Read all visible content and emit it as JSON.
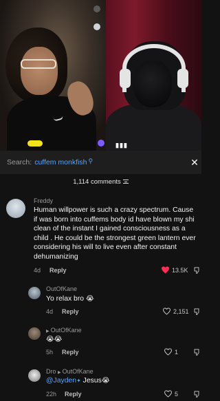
{
  "search": {
    "label": "Search:",
    "query": "cuffem monkfish",
    "search_icon": "search-icon",
    "close_icon": "close-icon"
  },
  "comments_header": {
    "count_text": "1,114 comments",
    "filter_icon": "filter-icon"
  },
  "colors": {
    "accent": "#54a3ff",
    "like_red": "#ff2d55",
    "background": "#121212"
  },
  "comments": [
    {
      "username": "Freddy",
      "text": "Human willpower is such a crazy spectrum. Cause if was born into cuffems body id have blown my shi clean of the instant I gained consciousness as a child . He could be the strongest green lantern ever considering his will to live even after constant dehumanizing",
      "time": "4d",
      "reply_label": "Reply",
      "likes": "13.5K",
      "liked": true
    }
  ],
  "replies": [
    {
      "username": "OutOfKane",
      "text": "Yo relax bro",
      "emoji": "😭",
      "time": "4d",
      "reply_label": "Reply",
      "likes": "2,151"
    },
    {
      "username": "OutOfKane",
      "text": "",
      "emoji": "😭😭",
      "time": "5h",
      "reply_label": "Reply",
      "likes": "1"
    },
    {
      "username": "Dro",
      "reply_to": "OutOfKane",
      "mention": "@Jayden",
      "text": "Jesus",
      "emoji": "😭",
      "time": "22h",
      "reply_label": "Reply",
      "likes": "5"
    }
  ]
}
